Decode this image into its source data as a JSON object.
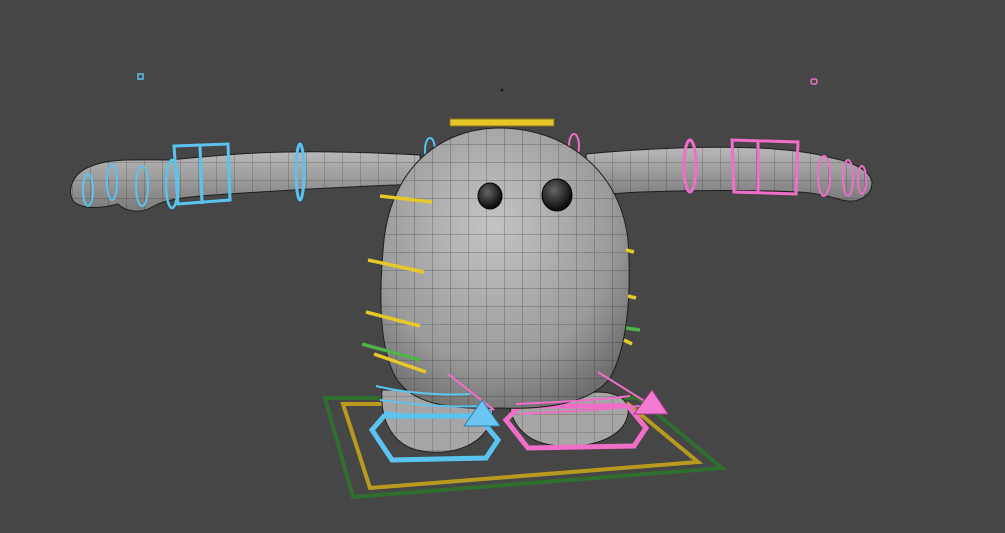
{
  "viewport": {
    "background": "#464646",
    "description_free": true
  },
  "character": {
    "mesh_color": "#9c9c9c",
    "wire_color": "#1e1e1e",
    "eye_color": "#111111"
  },
  "rig_colors": {
    "left_side": "#5ac3f0",
    "right_side": "#f06ec8",
    "center_yellow": "#e6c828",
    "center_green": "#4fb34a",
    "ground_green": "#2f6e2f",
    "ground_yellow": "#b89a1e"
  },
  "controls": [
    {
      "name": "head-control"
    },
    {
      "name": "left-arm-ik-control"
    },
    {
      "name": "right-arm-ik-control"
    },
    {
      "name": "left-foot-ik-control"
    },
    {
      "name": "right-foot-ik-control"
    },
    {
      "name": "root-control"
    },
    {
      "name": "world-control"
    }
  ]
}
